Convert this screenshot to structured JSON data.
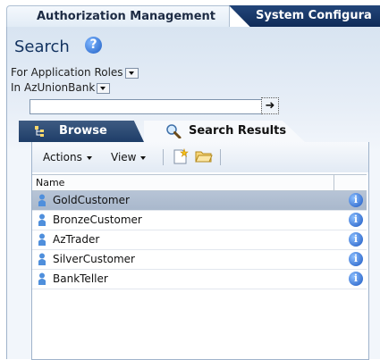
{
  "top_tabs": {
    "authorization": "Authorization Management",
    "system": "System Configura"
  },
  "search": {
    "heading": "Search",
    "for_label": "For",
    "for_value": "Application Roles",
    "in_label": "In",
    "in_value": "AzUnionBank",
    "input_value": "",
    "input_placeholder": ""
  },
  "tabs": {
    "browse": "Browse",
    "results": "Search Results"
  },
  "toolbar": {
    "actions": "Actions",
    "view": "View"
  },
  "table": {
    "column_name": "Name",
    "rows": [
      {
        "name": "GoldCustomer",
        "selected": true
      },
      {
        "name": "BronzeCustomer",
        "selected": false
      },
      {
        "name": "AzTrader",
        "selected": false
      },
      {
        "name": "SilverCustomer",
        "selected": false
      },
      {
        "name": "BankTeller",
        "selected": false
      }
    ]
  },
  "colors": {
    "accent": "#12325f",
    "selected_row": "#aebbcd",
    "info": "#1c57c1"
  }
}
